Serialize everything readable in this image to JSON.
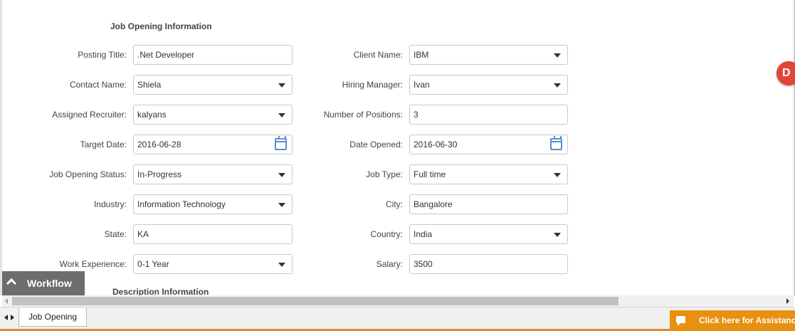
{
  "section_title": "Job Opening Information",
  "section2_title": "Description Information",
  "fields_left": [
    {
      "label": "Posting Title:",
      "value": ".Net Developer",
      "kind": "text"
    },
    {
      "label": "Contact Name:",
      "value": "Shiela",
      "kind": "select"
    },
    {
      "label": "Assigned Recruiter:",
      "value": "kalyans",
      "kind": "select"
    },
    {
      "label": "Target Date:",
      "value": "2016-06-28",
      "kind": "date"
    },
    {
      "label": "Job Opening Status:",
      "value": "In-Progress",
      "kind": "select"
    },
    {
      "label": "Industry:",
      "value": "Information Technology",
      "kind": "select"
    },
    {
      "label": "State:",
      "value": "KA",
      "kind": "text"
    },
    {
      "label": "Work Experience:",
      "value": "0-1 Year",
      "kind": "select"
    }
  ],
  "fields_right": [
    {
      "label": "Client Name:",
      "value": "IBM",
      "kind": "select"
    },
    {
      "label": "Hiring Manager:",
      "value": "Ivan",
      "kind": "select"
    },
    {
      "label": "Number of Positions:",
      "value": "3",
      "kind": "text"
    },
    {
      "label": "Date Opened:",
      "value": "2016-06-30",
      "kind": "date"
    },
    {
      "label": "Job Type:",
      "value": "Full time",
      "kind": "select"
    },
    {
      "label": "City:",
      "value": "Bangalore",
      "kind": "text"
    },
    {
      "label": "Country:",
      "value": "India",
      "kind": "select"
    },
    {
      "label": "Salary:",
      "value": "3500",
      "kind": "text"
    }
  ],
  "floating_button": "D",
  "workflow_label": "Workflow",
  "sheet_tab": "Job Opening",
  "assist_label": "Click here for Assistance",
  "icons": {
    "dropdown": "chevron-down-icon",
    "date": "calendar-icon",
    "workflow": "chevron-up-icon",
    "assist": "chat-icon"
  },
  "colors": {
    "accent_orange": "#e8900f",
    "float_red": "#e0453a",
    "workflow_gray": "#6d6d6d",
    "calendar_blue": "#5b8fc9"
  }
}
